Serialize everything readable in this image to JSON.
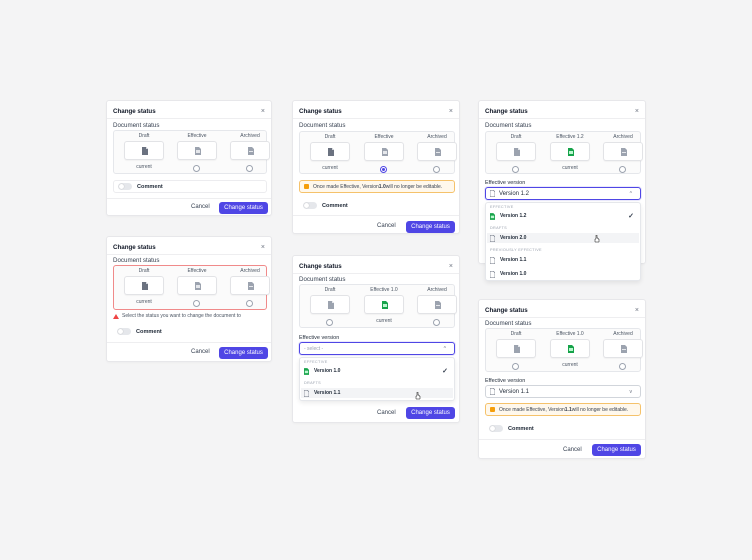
{
  "dialog": {
    "title": "Change status",
    "section_label": "Document status",
    "comment_label": "Comment",
    "cancel_label": "Cancel",
    "submit_label": "Change status",
    "close_glyph": "×"
  },
  "statuses": {
    "draft": "Draft",
    "effective": "Effective",
    "archived": "Archived",
    "effective_v10": "Effective 1.0",
    "effective_v12": "Effective 1.2",
    "current": "current"
  },
  "error_message": "Select the status you want to change the document to",
  "warnings": {
    "pre": "Once made Effective, Version ",
    "post": " will no longer be editable.",
    "v10": "1.0",
    "v11": "1.1"
  },
  "effective_version": {
    "label": "Effective version",
    "placeholder": "- select -",
    "value_v12": "Version 1.2",
    "value_v11": "Version 1.1",
    "chevron_up": "^",
    "chevron_down": "v"
  },
  "menu": {
    "group_effective": "EFFECTIVE",
    "group_drafts": "DRAFTS",
    "group_previous": "PREVIOUSLY EFFECTIVE",
    "v10": "Version 1.0",
    "v11": "Version 1.1",
    "v12": "Version 1.2",
    "v20": "Version 2.0",
    "check": "✓"
  },
  "icons": {
    "close": "close-icon",
    "check": "check-icon",
    "file_draft": "document-icon",
    "file_effective": "spreadsheet-icon",
    "file_archived": "archive-document-icon",
    "warning": "warning-icon",
    "error": "alert-triangle-icon",
    "chevron": "chevron-icon",
    "cursor": "hand-pointer-icon"
  },
  "colors": {
    "primary": "#4f46e5",
    "effective_green": "#16a34a",
    "warning_border": "#f5c26b",
    "warning_fill": "#f59e0b",
    "error": "#ef4444"
  }
}
